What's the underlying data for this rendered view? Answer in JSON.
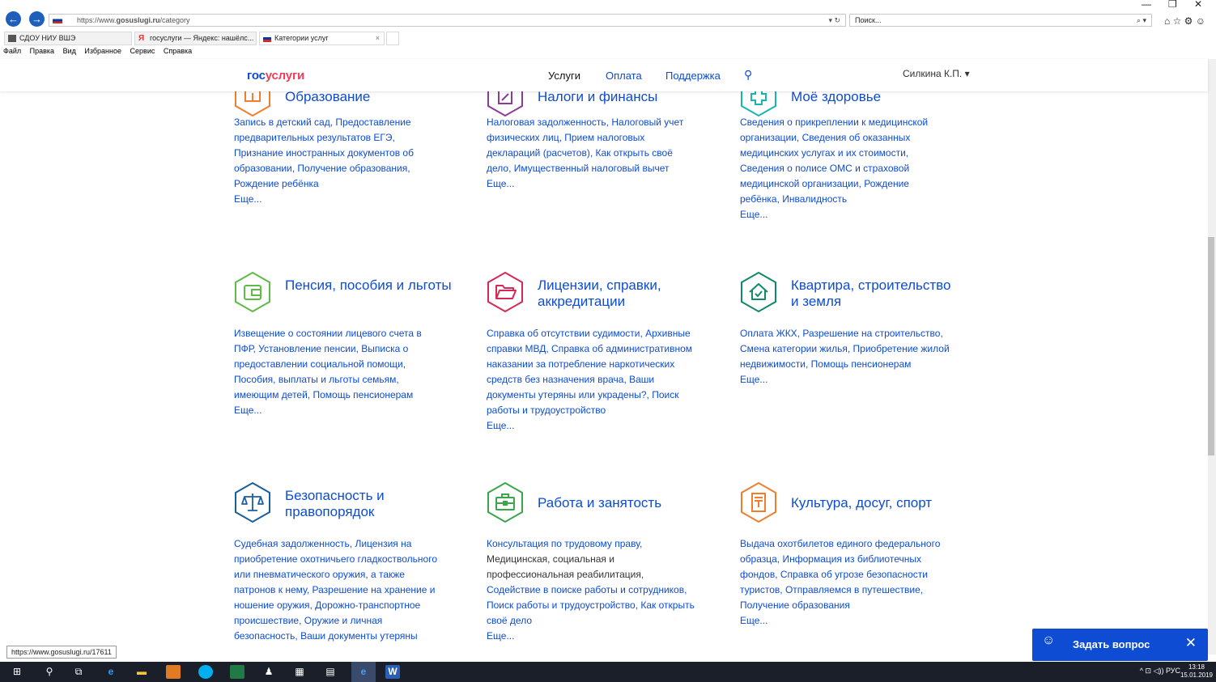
{
  "browser": {
    "url": "https://www.gosuslugi.ru/category",
    "url_host": "https://www.",
    "url_domain": "gosuslugi.ru",
    "url_path": "/category",
    "addr_ctrls": "▾ ↻",
    "search_placeholder": "Поиск...",
    "search_ctrls": "⌕ ▾",
    "tabs": [
      {
        "label": "СДОУ НИУ ВШЭ"
      },
      {
        "label": "госуслуги — Яндекс: нашёлс..."
      },
      {
        "label": "Категории услуг"
      }
    ],
    "tab_close": "×",
    "menu": [
      "Файл",
      "Правка",
      "Вид",
      "Избранное",
      "Сервис",
      "Справка"
    ],
    "win_min": "—",
    "win_restore": "❐",
    "win_close": "✕",
    "toolbar_icons": "⌂ ☆ ⚙ ☺"
  },
  "site": {
    "logo_a": "гос",
    "logo_b": "услуги",
    "nav": [
      "Услуги",
      "Оплата",
      "Поддержка"
    ],
    "search_glyph": "⚲",
    "user": "Силкина К.П. ▾"
  },
  "categories": [
    {
      "title": "Образование",
      "desc": "Запись в детский сад, Предоставление предварительных результатов ЕГЭ, Признание иностранных документов об образовании, Получение образования, Рождение ребёнка",
      "more": "Еще...",
      "color": "#f07e2d",
      "icon": "book-icon"
    },
    {
      "title": "Налоги и финансы",
      "desc": "Налоговая задолженность, Налоговый учет физических лиц, Прием налоговых деклараций (расчетов), Как открыть своё дело, Имущественный налоговый вычет",
      "more": "Еще...",
      "color": "#8e3b96",
      "icon": "percent-icon"
    },
    {
      "title": "Моё здоровье",
      "desc": "Сведения о прикреплении к медицинской организации, Сведения об оказанных медицинских услугах и их стоимости, Сведения о полисе ОМС и страховой медицинской организации, Рождение ребёнка, Инвалидность",
      "more": "Еще...",
      "color": "#19b5b5",
      "icon": "medical-cross-icon"
    },
    {
      "title": "Пенсия, пособия и льготы",
      "desc": "Извещение о состоянии лицевого счета в ПФР, Установление пенсии, Выписка о предоставлении социальной помощи, Пособия, выплаты и льготы семьям, имеющим детей, Помощь пенсионерам",
      "more": "Еще...",
      "color": "#5dbb46",
      "icon": "wallet-icon"
    },
    {
      "title": "Лицензии, справки, аккредитации",
      "desc": "Справка об отсутствии судимости, Архивные справки МВД, Справка об административном наказании за потребление наркотических средств без назначения врача, Ваши документы утеряны или украдены?, Поиск работы и трудоустройство",
      "more": "Еще...",
      "color": "#d42a55",
      "icon": "folder-icon"
    },
    {
      "title": "Квартира, строительство и земля",
      "desc": "Оплата ЖКХ, Разрешение на строительство, Смена категории жилья, Приобретение жилой недвижимости, Помощь пенсионерам",
      "more": "Еще...",
      "color": "#0f8a6a",
      "icon": "house-icon"
    },
    {
      "title": "Безопасность и правопорядок",
      "desc": "Судебная задолженность, Лицензия на приобретение охотничьего гладкоствольного или пневматического оружия, а также патронов к нему, Разрешение на хранение и ношение оружия, Дорожно-транспортное происшествие, Оружие и личная безопасность, Ваши документы утеряны",
      "more": "",
      "color": "#1b5e9e",
      "icon": "scales-icon"
    },
    {
      "title": "Работа и занятость",
      "desc_a": "Консультация по трудовому праву,",
      "desc_b": "Медицинская, социальная и профессиональная реабилитация",
      "desc_c": ", Содействие в поиске работы и сотрудников, Поиск работы и трудоустройство, Как открыть своё дело",
      "more": "Еще...",
      "color": "#3aa54a",
      "icon": "briefcase-icon"
    },
    {
      "title": "Культура, досуг, спорт",
      "desc": "Выдача охотбилетов единого федерального образца, Информация из библиотечных фондов, Справка об угрозе безопасности туристов, Отправляемся в путешествие, Получение образования",
      "more": "Еще...",
      "color": "#f07e2d",
      "icon": "ticket-icon"
    }
  ],
  "status_url": "https://www.gosuslugi.ru/17611",
  "ask": {
    "label": "Задать вопрос",
    "icon": "chat-face-icon",
    "close": "✕"
  },
  "taskbar": {
    "tray": "^ ⊡ ◁)) РУС",
    "time": "13:18",
    "date": "15.01.2019"
  }
}
